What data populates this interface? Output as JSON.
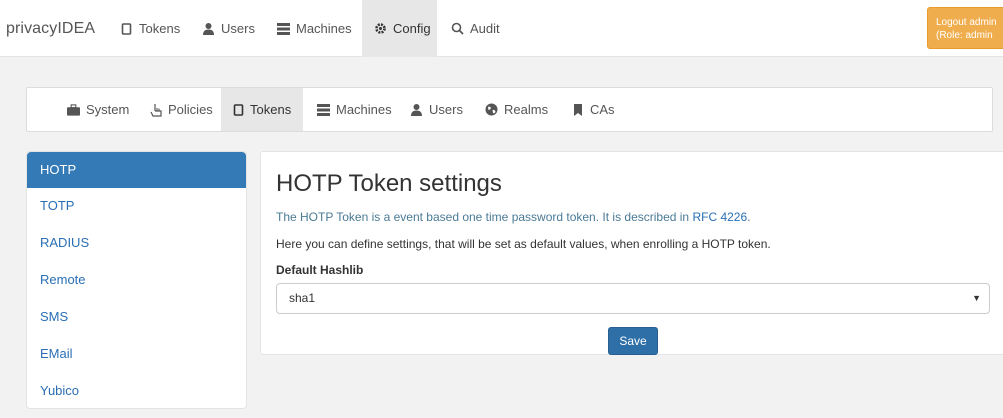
{
  "topnav": {
    "brand": "privacyIDEA",
    "items": [
      {
        "label": "Tokens",
        "icon": "token-icon"
      },
      {
        "label": "Users",
        "icon": "user-icon"
      },
      {
        "label": "Machines",
        "icon": "server-icon"
      },
      {
        "label": "Config",
        "icon": "gear-icon",
        "active": true
      },
      {
        "label": "Audit",
        "icon": "search-icon"
      }
    ],
    "logout_line1": "Logout admin",
    "logout_line2": "(Role: admin"
  },
  "subnav": {
    "items": [
      {
        "label": "System",
        "icon": "briefcase-icon"
      },
      {
        "label": "Policies",
        "icon": "hand-icon"
      },
      {
        "label": "Tokens",
        "icon": "token-icon",
        "active": true
      },
      {
        "label": "Machines",
        "icon": "server-icon"
      },
      {
        "label": "Users",
        "icon": "user-icon"
      },
      {
        "label": "Realms",
        "icon": "globe-icon"
      },
      {
        "label": "CAs",
        "icon": "bookmark-icon"
      }
    ]
  },
  "sidebar": {
    "items": [
      {
        "label": "HOTP",
        "active": true
      },
      {
        "label": "TOTP"
      },
      {
        "label": "RADIUS"
      },
      {
        "label": "Remote"
      },
      {
        "label": "SMS"
      },
      {
        "label": "EMail"
      },
      {
        "label": "Yubico"
      }
    ]
  },
  "panel": {
    "title": "HOTP Token settings",
    "desc_prefix": "The HOTP Token is a event based one time password token. It is described in ",
    "desc_link": "RFC 4226",
    "desc_suffix": ".",
    "help": "Here you can define settings, that will be set as default values, when enrolling a HOTP token.",
    "hashlib_label": "Default Hashlib",
    "hashlib_value": "sha1",
    "save_label": "Save"
  },
  "colors": {
    "accent": "#337ab7",
    "logout": "#f0ad4e"
  }
}
